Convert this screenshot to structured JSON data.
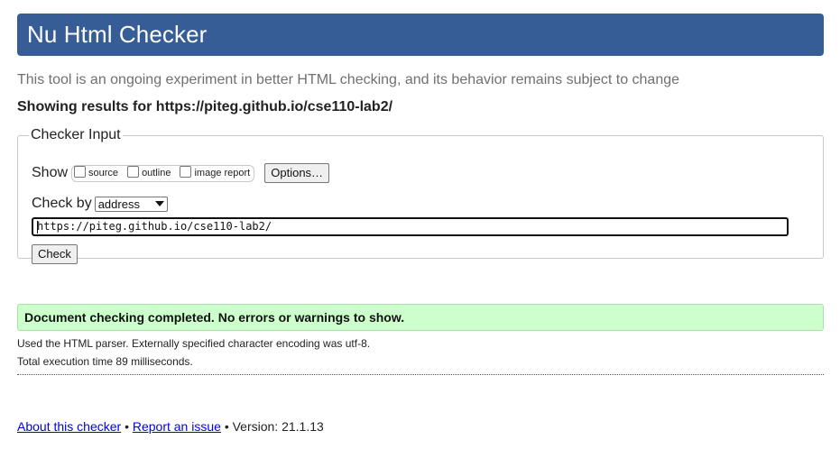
{
  "header": {
    "title": "Nu Html Checker"
  },
  "intro": "This tool is an ongoing experiment in better HTML checking, and its behavior remains subject to change",
  "showing": "Showing results for https://piteg.github.io/cse110-lab2/",
  "checker_input": {
    "legend": "Checker Input",
    "show_label": "Show",
    "options": [
      {
        "label": "source",
        "checked": false
      },
      {
        "label": "outline",
        "checked": false
      },
      {
        "label": "image report",
        "checked": false
      }
    ],
    "options_button": "Options…",
    "check_by_label": "Check by",
    "check_by_selected": "address",
    "url_value": "https://piteg.github.io/cse110-lab2/",
    "check_button": "Check"
  },
  "result": {
    "message": "Document checking completed. No errors or warnings to show."
  },
  "meta": {
    "parser": "Used the HTML parser. Externally specified character encoding was utf-8.",
    "time": "Total execution time 89 milliseconds."
  },
  "footer": {
    "about_link": "About this checker",
    "separator": "•",
    "report_link": "Report an issue",
    "version": "• Version: 21.1.13"
  },
  "colors": {
    "header_bg": "#365d95",
    "result_bg": "#ccffcc",
    "link": "#0000ee"
  }
}
